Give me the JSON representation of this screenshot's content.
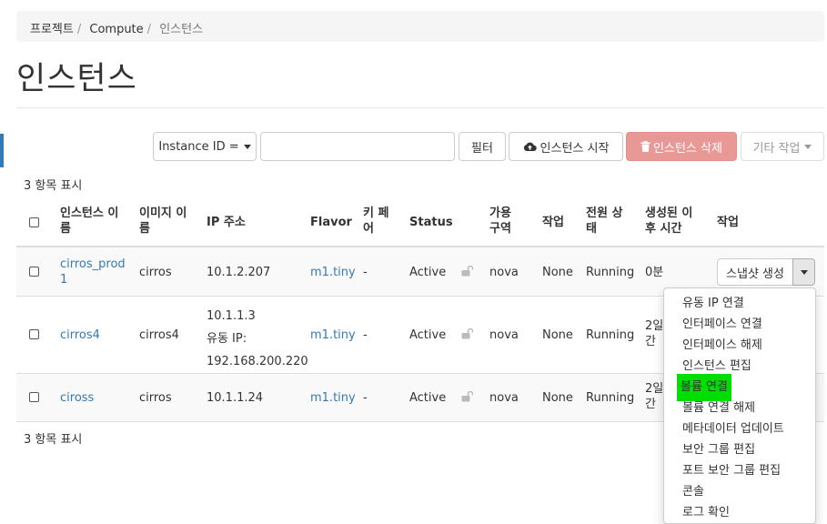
{
  "breadcrumb": [
    "프로젝트",
    "Compute",
    "인스턴스"
  ],
  "page_title": "인스턴스",
  "toolbar": {
    "filter_select": "Instance ID =",
    "filter_input_value": "",
    "filter_button": "필터",
    "launch_button": "인스턴스 시작",
    "delete_button": "인스턴스 삭제",
    "more_button": "기타 작업"
  },
  "count_top": "3 항목 표시",
  "count_bottom": "3 항목 표시",
  "columns": {
    "name": [
      "인스턴스 이",
      "름"
    ],
    "image": [
      "이미지 이",
      "름"
    ],
    "ip": "IP 주소",
    "flavor": "Flavor",
    "keypair": [
      "키 페",
      "어"
    ],
    "status": "Status",
    "az": [
      "가용",
      "구역"
    ],
    "task": "작업",
    "power": [
      "전원 상",
      "태"
    ],
    "age": [
      "생성된 이",
      "후 시간"
    ],
    "actions": "작업"
  },
  "rows": [
    {
      "name": [
        "cirros_prod",
        "1"
      ],
      "image": "cirros",
      "ip": [
        "10.1.2.207"
      ],
      "flavor": "m1.tiny",
      "keypair": "-",
      "status": "Active",
      "az": "nova",
      "task": "None",
      "power": "Running",
      "age": [
        "0분"
      ]
    },
    {
      "name": [
        "cirros4"
      ],
      "image": "cirros4",
      "ip": [
        "10.1.1.3",
        "유동 IP:",
        "192.168.200.220"
      ],
      "flavor": "m1.tiny",
      "keypair": "-",
      "status": "Active",
      "az": "nova",
      "task": "None",
      "power": "Running",
      "age": [
        "2일",
        "간"
      ]
    },
    {
      "name": [
        "ciross"
      ],
      "image": "cirros",
      "ip": [
        "10.1.1.24"
      ],
      "flavor": "m1.tiny",
      "keypair": "-",
      "status": "Active",
      "az": "nova",
      "task": "None",
      "power": "Running",
      "age": [
        "2일",
        "간"
      ]
    }
  ],
  "row_action_button": "스냅샷 생성",
  "dropdown_items": [
    "유동 IP 연결",
    "인터페이스 연결",
    "인터페이스 해제",
    "인스턴스 편집",
    "볼륨 연결",
    "볼륨 연결 해제",
    "메타데이터 업데이트",
    "보안 그룹 편집",
    "포트 보안 그룹 편집",
    "콘솔",
    "로그 확인"
  ],
  "colors": {
    "link": "#337ab7",
    "danger_button": "#e99995",
    "highlight": "#00dd00",
    "accent_bar": "#337ab7"
  }
}
